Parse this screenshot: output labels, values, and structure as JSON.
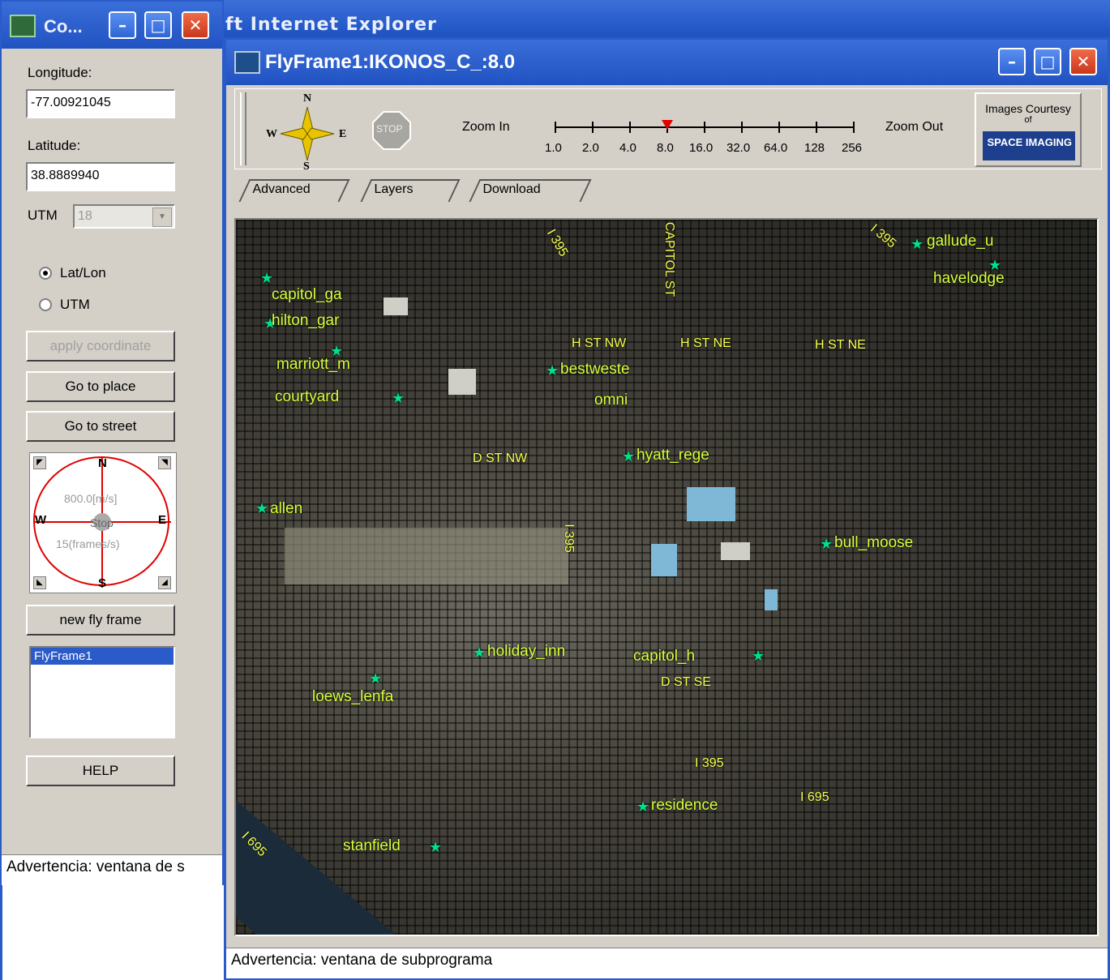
{
  "background_window": {
    "title": "ft Internet Explorer"
  },
  "control_window": {
    "title": "Co...",
    "longitude_label": "Longitude:",
    "longitude_value": "-77.00921045",
    "latitude_label": "Latitude:",
    "latitude_value": "38.8889940",
    "utm_label": "UTM",
    "utm_zone": "18",
    "radio_latlon": "Lat/Lon",
    "radio_utm": "UTM",
    "apply_button": "apply coordinate",
    "goto_place_button": "Go to place",
    "goto_street_button": "Go to street",
    "compass": {
      "n": "N",
      "s": "S",
      "e": "E",
      "w": "W",
      "speed": "800.0[m/s]",
      "stop": "Stop",
      "fps": "15(frames/s)"
    },
    "new_fly_frame_button": "new fly frame",
    "frames": [
      "FlyFrame1"
    ],
    "help_button": "HELP",
    "status": "Advertencia: ventana de s"
  },
  "fly_window": {
    "title": "FlyFrame1:IKONOS_C_:8.0",
    "compass_rose": {
      "n": "N",
      "s": "S",
      "e": "E",
      "w": "W"
    },
    "stop_label": "STOP",
    "zoom_in_label": "Zoom In",
    "zoom_out_label": "Zoom Out",
    "zoom_levels": [
      "1.0",
      "2.0",
      "4.0",
      "8.0",
      "16.0",
      "32.0",
      "64.0",
      "128",
      "256"
    ],
    "current_zoom": "8.0",
    "credit_line1": "Images Courtesy",
    "credit_line2": "of",
    "credit_logo": "SPACE IMAGING",
    "tabs": [
      "Advanced",
      "Layers",
      "Download"
    ],
    "map_labels": {
      "pois": [
        "gallude_u",
        "havelodge",
        "capitol_ga",
        "hilton_gar",
        "marriott_m",
        "courtyard",
        "bestweste",
        "omni",
        "hyatt_rege",
        "allen",
        "bull_moose",
        "holiday_inn",
        "capitol_h",
        "loews_lenfa",
        "residence",
        "stanfield"
      ],
      "streets": [
        "H ST NW",
        "H ST NE",
        "H ST NE",
        "D ST NW",
        "I 395",
        "D ST SE",
        "I 395",
        "I 695",
        "I 395",
        "CAPITOL ST",
        "I 395",
        "I 695"
      ]
    },
    "status": "Advertencia: ventana de subprograma"
  }
}
